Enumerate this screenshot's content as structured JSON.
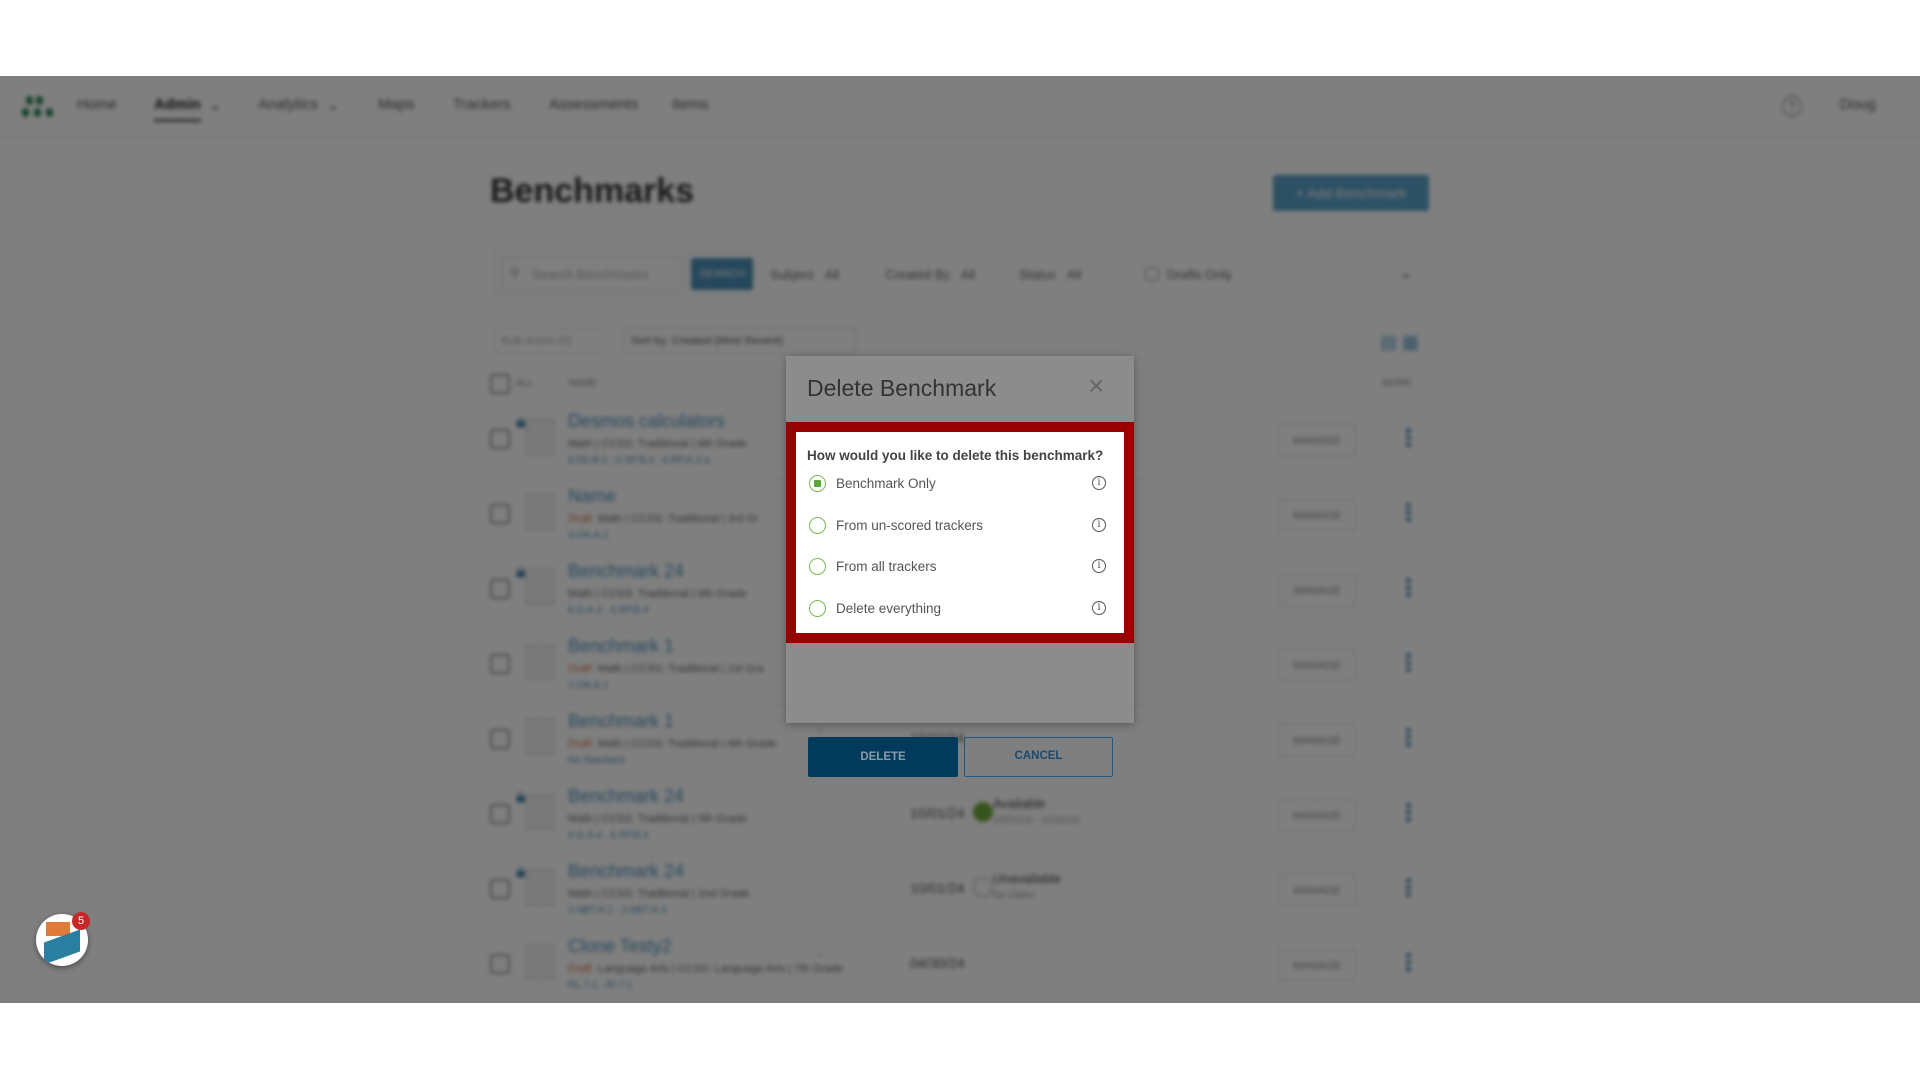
{
  "nav": {
    "items": [
      "Home",
      "Admin",
      "Analytics",
      "Maps",
      "Trackers",
      "Assessments",
      "Items"
    ],
    "active": "Admin",
    "help": "?",
    "user": "Doug"
  },
  "page": {
    "title": "Benchmarks",
    "add_button": "+ Add Benchmark"
  },
  "filters": {
    "search_placeholder": "Search Benchmarks",
    "search_button": "SEARCH",
    "subject_label": "Subject",
    "subject_value": "All",
    "created_by_label": "Created By",
    "created_by_value": "All",
    "status_label": "Status",
    "status_value": "All",
    "drafts_only": "Drafts Only"
  },
  "toolbar": {
    "bulk_action": "Bulk Action (0)",
    "sort": "Sort by: Created (Most Recent)"
  },
  "table": {
    "headers": {
      "all": "ALL",
      "name": "NAME",
      "more": "MORE"
    },
    "manage_label": "MANAGE",
    "rows": [
      {
        "name": "Desmos calculators",
        "locked": true,
        "draft": "",
        "meta": "Math | CCSS: Traditional | 6th Grade",
        "standards": "6.EE.B.5 , 6.SP.B.4 , 6.RP.A.3.a",
        "date": "",
        "status": "",
        "status_sub": ""
      },
      {
        "name": "Name",
        "locked": false,
        "draft": "Draft",
        "meta": "Math | CCSS: Traditional | 3rd Gr",
        "standards": "3.OA.A.1",
        "date": "",
        "status": "",
        "status_sub": ""
      },
      {
        "name": "Benchmark 24",
        "locked": true,
        "draft": "",
        "meta": "Math | CCSS: Traditional | 6th Grade",
        "standards": "6.G.A.4 , 6.SP.B.4",
        "date": "",
        "status": "",
        "status_sub": ""
      },
      {
        "name": "Benchmark 1",
        "locked": false,
        "draft": "Draft",
        "meta": "Math | CCSS: Traditional | 1st Gra",
        "standards": "1.OA.A.1",
        "date": "",
        "status": "",
        "status_sub": ""
      },
      {
        "name": "Benchmark 1",
        "locked": false,
        "draft": "Draft",
        "meta": "Math | CCSS: Traditional | 6th Grade",
        "standards": "No Standard",
        "date": "10/22/24",
        "status": "-",
        "status_sub": ""
      },
      {
        "name": "Benchmark 24",
        "locked": true,
        "draft": "",
        "meta": "Math | CCSS: Traditional | 5th Grade",
        "standards": "6.G.A.4 , 6.SP.B.4",
        "date": "10/01/24",
        "status": "Available",
        "status_sub": "10/01/24 - 10/31/24",
        "dot": "#6fa83a"
      },
      {
        "name": "Benchmark 24",
        "locked": true,
        "draft": "",
        "meta": "Math | CCSS: Traditional | 2nd Grade",
        "standards": "2.NBT.A.1 , 2.NBT.A.3",
        "date": "10/01/24",
        "status": "Unavailable",
        "status_sub": "No Dates",
        "dot": "clock"
      },
      {
        "name": "Clone Testy2",
        "locked": false,
        "draft": "Draft",
        "meta": "Language Arts | CCSS: Language Arts | 7th Grade",
        "standards": "RL.7.1 , RI.7.1",
        "date": "04/30/24",
        "status": "-",
        "status_sub": ""
      }
    ]
  },
  "chat": {
    "badge": "5"
  },
  "dialog": {
    "title": "Delete Benchmark",
    "close": "×",
    "question": "How would you like to delete this benchmark?",
    "options": [
      {
        "label": "Benchmark Only",
        "selected": true
      },
      {
        "label": "From un-scored trackers",
        "selected": false
      },
      {
        "label": "From all trackers",
        "selected": false
      },
      {
        "label": "Delete everything",
        "selected": false
      }
    ],
    "delete_button": "DELETE",
    "cancel_button": "CANCEL"
  },
  "colors": {
    "highlight": "#990000",
    "primary": "#023a5c",
    "radio": "#5aa832"
  }
}
